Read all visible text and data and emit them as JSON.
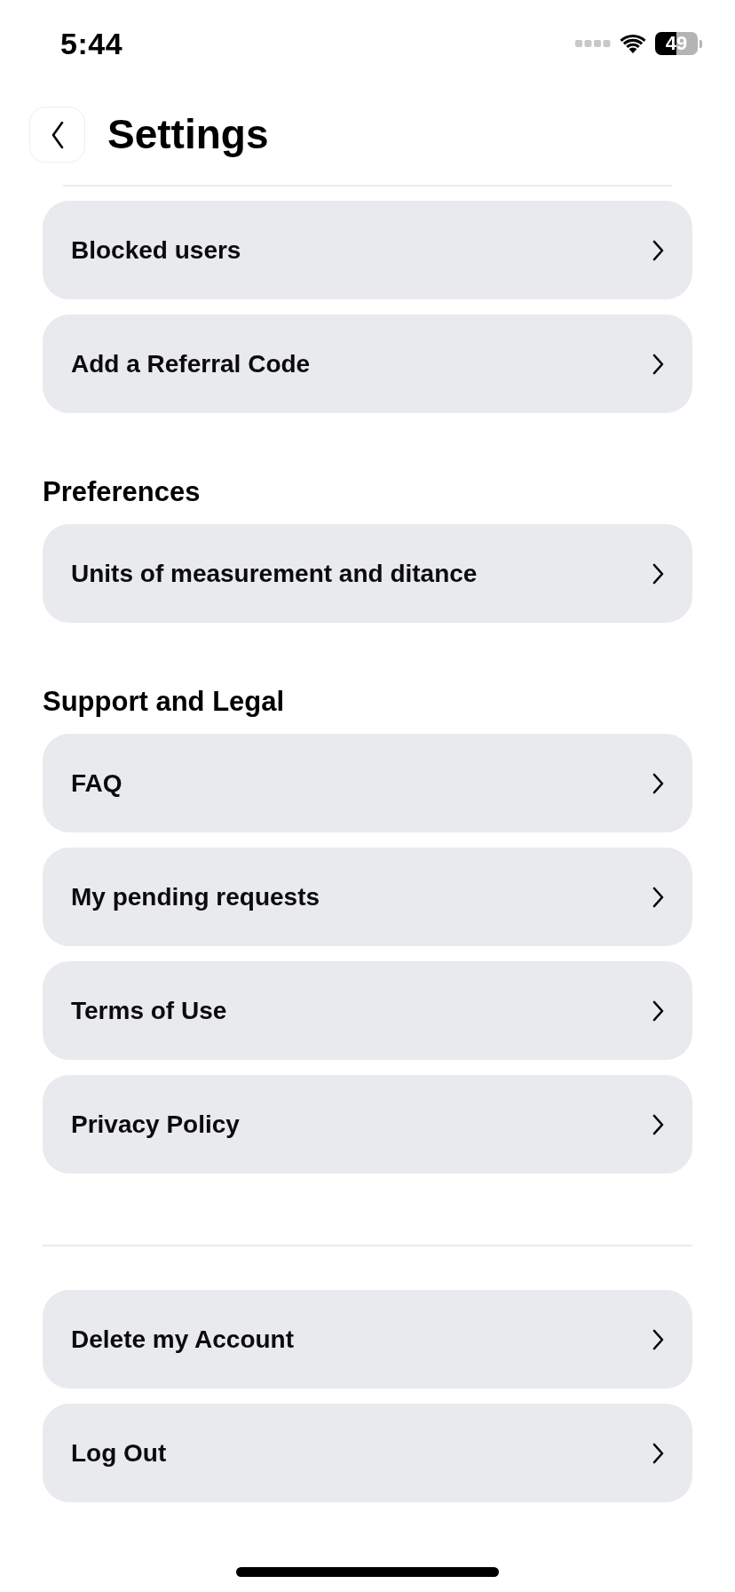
{
  "status_bar": {
    "time": "5:44",
    "battery": "49"
  },
  "header": {
    "title": "Settings"
  },
  "sections": [
    {
      "items": [
        {
          "label": "Blocked users"
        },
        {
          "label": "Add a Referral Code"
        }
      ]
    },
    {
      "title": "Preferences",
      "items": [
        {
          "label": "Units of measurement and ditance"
        }
      ]
    },
    {
      "title": "Support and Legal",
      "items": [
        {
          "label": "FAQ"
        },
        {
          "label": "My pending requests"
        },
        {
          "label": "Terms of Use"
        },
        {
          "label": "Privacy Policy"
        }
      ]
    },
    {
      "items": [
        {
          "label": "Delete my Account"
        },
        {
          "label": "Log Out"
        }
      ]
    }
  ]
}
